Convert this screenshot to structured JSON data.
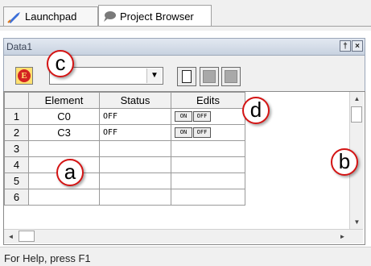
{
  "tabs": [
    {
      "label": "Launchpad",
      "icon": "rocket-icon",
      "active": false
    },
    {
      "label": "Project Browser",
      "icon": "speech-bubble-icon",
      "active": true
    }
  ],
  "panel": {
    "title": "Data1",
    "pin_label": "†",
    "close_label": "×"
  },
  "toolbar": {
    "e_label": "E",
    "combo_value": "",
    "combo_arrow": "▼"
  },
  "grid": {
    "columns": [
      "Element",
      "Status",
      "Edits"
    ],
    "rows": [
      {
        "num": "1",
        "element": "C0",
        "status": "OFF",
        "edits": [
          "ON",
          "OFF"
        ]
      },
      {
        "num": "2",
        "element": "C3",
        "status": "OFF",
        "edits": [
          "ON",
          "OFF"
        ]
      },
      {
        "num": "3",
        "element": "",
        "status": "",
        "edits": []
      },
      {
        "num": "4",
        "element": "",
        "status": "",
        "edits": []
      },
      {
        "num": "5",
        "element": "",
        "status": "",
        "edits": []
      },
      {
        "num": "6",
        "element": "",
        "status": "",
        "edits": []
      }
    ]
  },
  "scroll": {
    "up": "▲",
    "down": "▼",
    "left": "◄",
    "right": "►"
  },
  "status_bar": {
    "text": "For Help, press F1"
  },
  "callouts": {
    "a": "a",
    "b": "b",
    "c": "c",
    "d": "d"
  },
  "colors": {
    "callout_border": "#d41414",
    "title_bar": "#c8d2e0"
  }
}
